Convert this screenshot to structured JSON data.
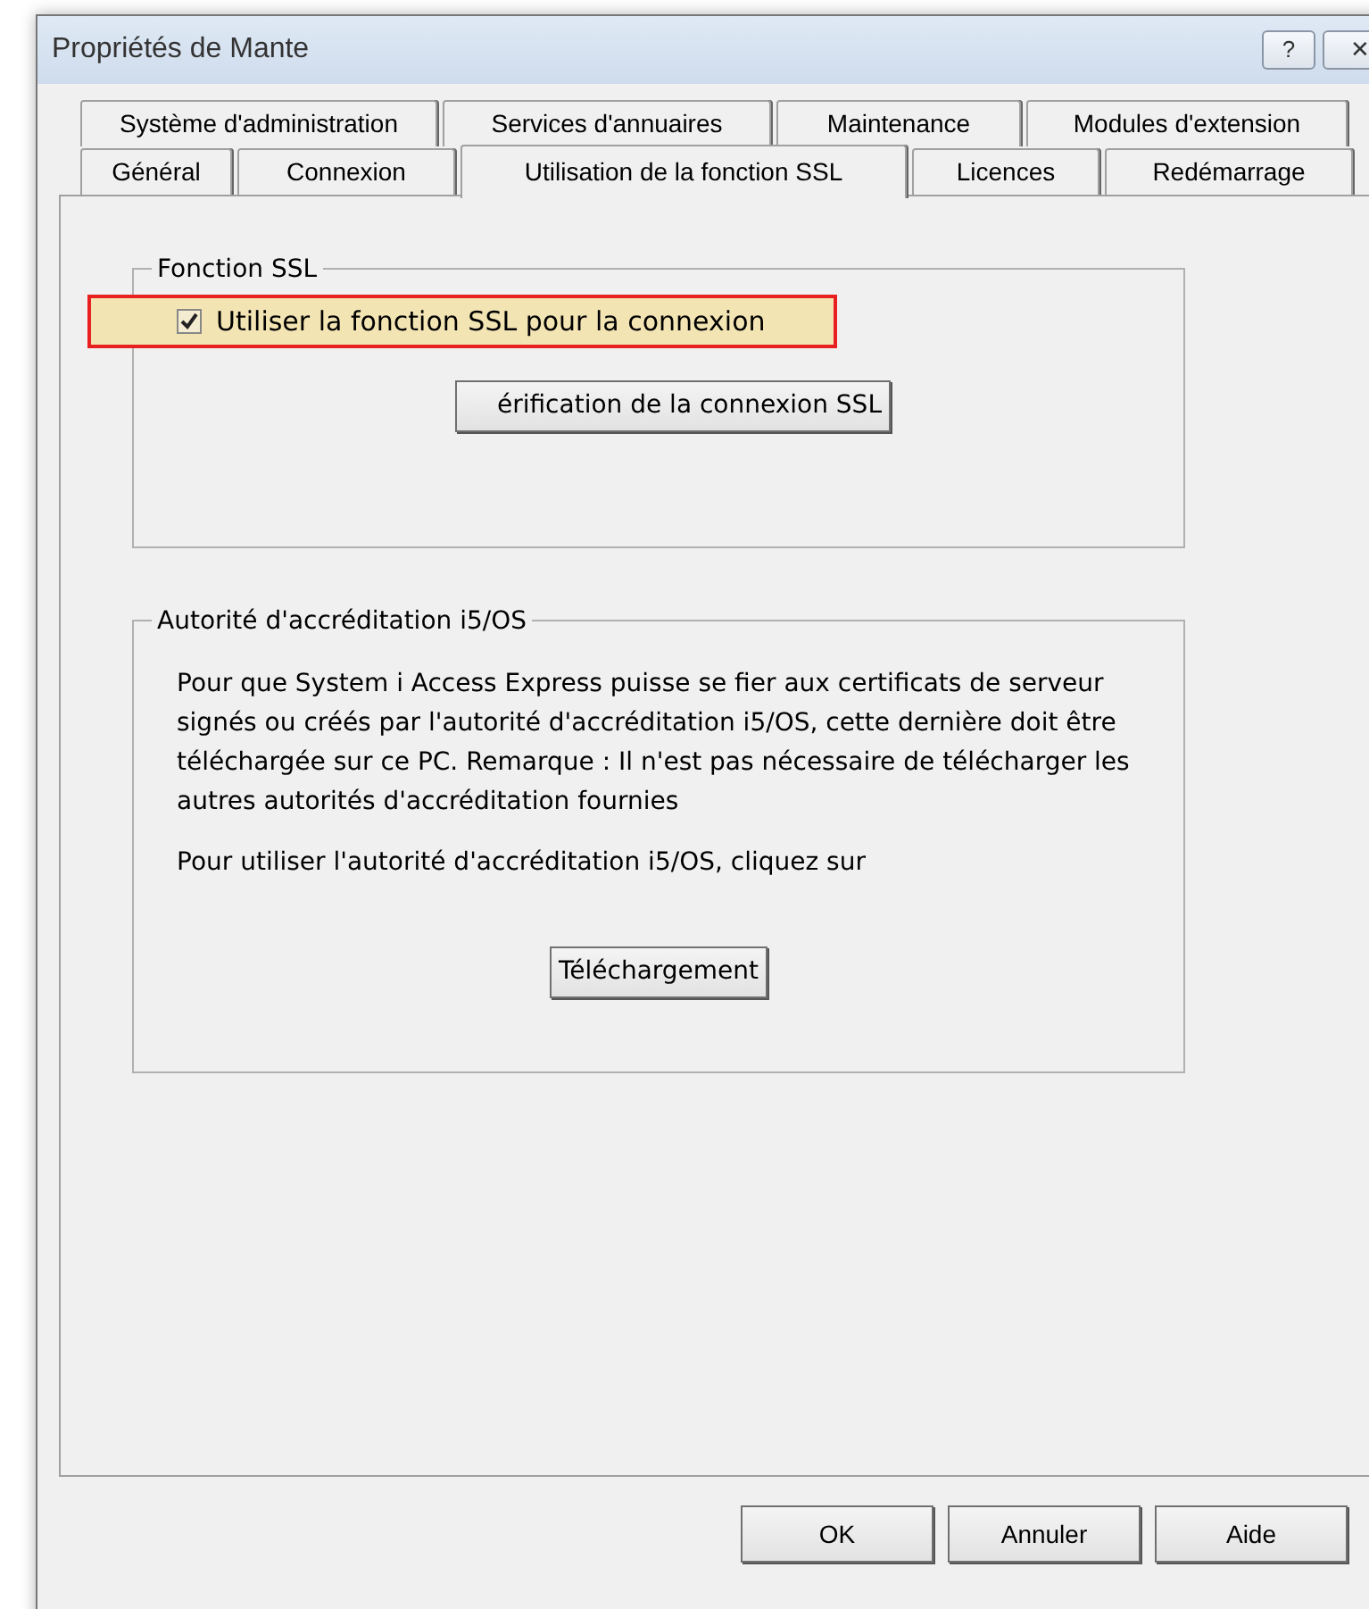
{
  "window": {
    "title": "Propriétés de Mante",
    "title_buttons": [
      {
        "label": "?"
      },
      {
        "label": "✕"
      }
    ]
  },
  "tab_rows": [
    [
      {
        "label": "Système d'administration",
        "selected": false
      },
      {
        "label": "Services d'annuaires",
        "selected": false
      },
      {
        "label": "Maintenance",
        "selected": false
      },
      {
        "label": "Modules d'extension",
        "selected": false
      }
    ],
    [
      {
        "label": "Général",
        "selected": false
      },
      {
        "label": "Connexion",
        "selected": false
      },
      {
        "label": "Utilisation de la fonction SSL",
        "selected": true
      },
      {
        "label": "Licences",
        "selected": false
      },
      {
        "label": "Redémarrage",
        "selected": false
      }
    ]
  ],
  "ssl_group": {
    "legend": "Fonction SSL",
    "checkbox": {
      "label": "Utiliser la fonction SSL pour la connexion",
      "checked": true,
      "highlighted": true
    },
    "button": "érification de la connexion SSL"
  },
  "ca_group": {
    "legend": "Autorité d'accréditation i5/OS",
    "description": "Pour que System i Access Express puisse se fier aux certificats de serveur signés ou créés par l'autorité d'accréditation i5/OS, cette dernière doit être téléchargée sur ce PC. Remarque : Il n'est pas nécessaire de télécharger les autres autorités d'accréditation fournies",
    "instruction": "Pour utiliser l'autorité d'accréditation i5/OS, cliquez sur",
    "button": "Téléchargement"
  },
  "footer_buttons": [
    "OK",
    "Annuler",
    "Aide"
  ]
}
